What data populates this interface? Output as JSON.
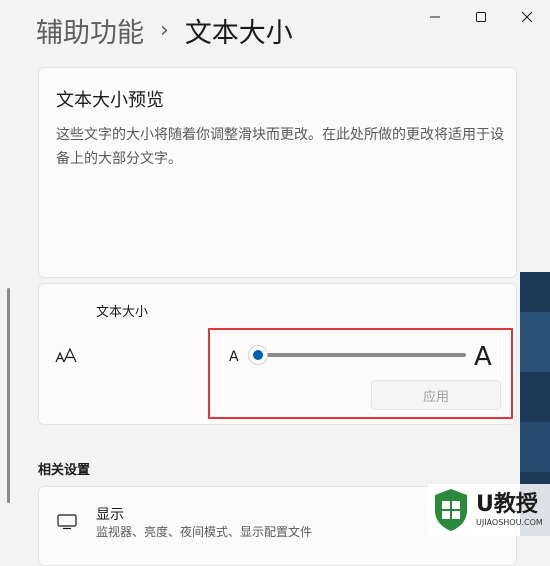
{
  "window": {
    "minimize_icon": "minimize-icon",
    "maximize_icon": "maximize-icon",
    "close_icon": "close-icon"
  },
  "header": {
    "parent": "辅助功能",
    "separator": "›",
    "current": "文本大小"
  },
  "preview": {
    "title": "文本大小预览",
    "description": "这些文字的大小将随着你调整滑块而更改。在此处所做的更改将适用于设备上的大部分文字。"
  },
  "text_size": {
    "label": "文本大小",
    "icon": "text-size-icon",
    "small_marker": "A",
    "large_marker": "A",
    "slider_value": 0,
    "apply_button": "应用",
    "apply_enabled": false
  },
  "related": {
    "heading": "相关设置",
    "display": {
      "title": "显示",
      "subtitle": "监视器、亮度、夜间模式、显示配置文件",
      "icon": "monitor-icon"
    }
  },
  "watermark": {
    "brand": "U教授",
    "domain": "UJIAOSHOU.COM"
  },
  "colors": {
    "accent": "#005fb8",
    "highlight": "#e0373b"
  }
}
